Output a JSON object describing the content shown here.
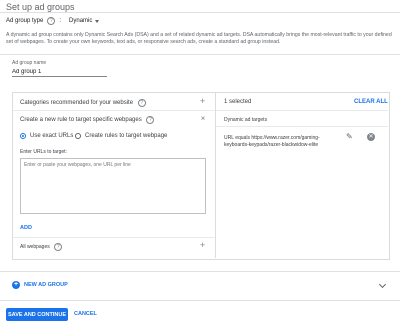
{
  "page": {
    "title": "Set up ad groups",
    "ad_group_type_label": "Ad group type",
    "ad_group_type_value": "Dynamic",
    "description": "A dynamic ad group contains only Dynamic Search Ads (DSA) and a set of related dynamic ad targets. DSA automatically brings the most-relevant traffic to your defined set of webpages. To create your own keywords, text ads, or responsive search ads, create a standard ad group instead."
  },
  "ad_group": {
    "name_label": "Ad group name",
    "name_value": "Ad group 1"
  },
  "left_panel": {
    "categories_label": "Categories recommended for your website",
    "create_rule_label": "Create a new rule to target specific webpages",
    "option_exact": "Use exact URLs",
    "option_rules": "Create rules to target webpage",
    "enter_urls_label": "Enter URLs to target:",
    "urls_placeholder": "Enter or paste your webpages, one URL per line",
    "add_label": "ADD",
    "all_webpages_label": "All webpages"
  },
  "right_panel": {
    "selected_count": "1 selected",
    "clear_all": "CLEAR ALL",
    "targets_header": "Dynamic ad targets",
    "target_line1": "URL equals https://www.razer.com/gaming-",
    "target_line2": "keyboards-keypads/razer-blackwidow-elite"
  },
  "new_ad_group": {
    "label": "NEW AD GROUP"
  },
  "actions": {
    "save_label": "SAVE AND CONTINUE",
    "cancel_label": "CANCEL"
  },
  "colors": {
    "accent": "#1a73e8",
    "border": "#dadce0",
    "text": "#3c4043"
  },
  "icons": [
    "help-icon",
    "caret-down-icon",
    "plus-icon",
    "pencil-icon",
    "remove-icon",
    "add-circle-icon",
    "chevron-down-icon"
  ]
}
